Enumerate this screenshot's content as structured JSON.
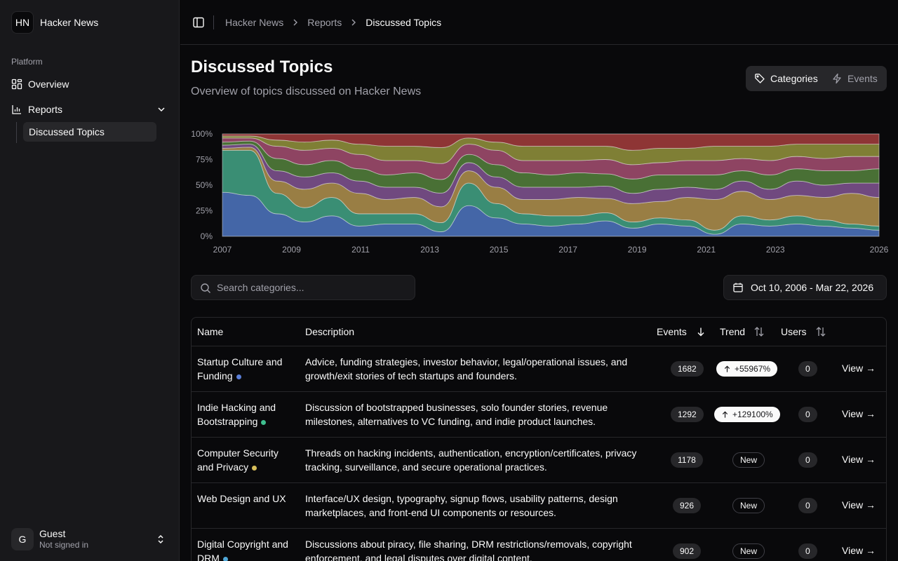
{
  "app": {
    "logo": "HN",
    "name": "Hacker News"
  },
  "sidebar": {
    "group_label": "Platform",
    "items": [
      {
        "label": "Overview",
        "icon": "layout-grid-icon"
      },
      {
        "label": "Reports",
        "icon": "bar-chart-icon"
      }
    ],
    "sub_items": [
      {
        "label": "Discussed Topics"
      }
    ]
  },
  "user": {
    "initial": "G",
    "name": "Guest",
    "status": "Not signed in"
  },
  "breadcrumb": [
    "Hacker News",
    "Reports",
    "Discussed Topics"
  ],
  "page": {
    "title": "Discussed Topics",
    "subtitle": "Overview of topics discussed on Hacker News"
  },
  "view_toggle": {
    "options": [
      "Categories",
      "Events"
    ],
    "active": "Categories"
  },
  "chart_data": {
    "type": "area",
    "stacked": "normalized",
    "x_ticks": [
      "2007",
      "2009",
      "2011",
      "2013",
      "2015",
      "2017",
      "2019",
      "2021",
      "2023",
      "2026"
    ],
    "y_ticks": [
      "0%",
      "25%",
      "50%",
      "75%",
      "100%"
    ],
    "ylim": [
      0,
      100
    ],
    "series": [
      {
        "color": "#4a6fb5",
        "values": [
          43,
          40,
          22,
          14,
          20,
          10,
          12,
          12,
          4,
          30,
          18,
          12,
          10,
          12,
          15,
          8,
          12,
          10,
          2,
          12,
          10,
          12,
          10,
          8,
          6
        ]
      },
      {
        "color": "#3f9a7e",
        "values": [
          41,
          44,
          20,
          14,
          18,
          12,
          10,
          10,
          8,
          22,
          14,
          10,
          10,
          8,
          8,
          6,
          6,
          6,
          4,
          8,
          6,
          8,
          6,
          4,
          4
        ]
      },
      {
        "color": "#a6894a",
        "values": [
          2,
          3,
          12,
          18,
          14,
          20,
          14,
          16,
          14,
          12,
          16,
          14,
          16,
          18,
          14,
          18,
          16,
          22,
          30,
          24,
          20,
          20,
          22,
          30,
          28
        ]
      },
      {
        "color": "#7a4f8a",
        "values": [
          3,
          3,
          10,
          12,
          10,
          12,
          12,
          10,
          12,
          8,
          10,
          12,
          12,
          10,
          12,
          10,
          12,
          10,
          10,
          10,
          10,
          14,
          12,
          10,
          14
        ]
      },
      {
        "color": "#4f7a3a",
        "values": [
          3,
          3,
          12,
          12,
          12,
          12,
          12,
          14,
          12,
          8,
          12,
          14,
          12,
          14,
          12,
          14,
          14,
          12,
          14,
          10,
          14,
          12,
          14,
          12,
          14
        ]
      },
      {
        "color": "#9a4a6a",
        "values": [
          4,
          3,
          12,
          14,
          12,
          14,
          14,
          12,
          14,
          10,
          14,
          12,
          14,
          12,
          14,
          14,
          12,
          14,
          14,
          12,
          14,
          12,
          12,
          14,
          12
        ]
      },
      {
        "color": "#8a8a3a",
        "values": [
          2,
          2,
          6,
          8,
          8,
          10,
          14,
          14,
          14,
          6,
          8,
          14,
          14,
          14,
          13,
          14,
          14,
          12,
          14,
          12,
          14,
          12,
          14,
          12,
          12
        ]
      },
      {
        "color": "#9a3a3a",
        "values": [
          2,
          2,
          6,
          8,
          6,
          10,
          12,
          12,
          12,
          4,
          8,
          12,
          12,
          12,
          12,
          16,
          14,
          14,
          12,
          12,
          12,
          10,
          10,
          10,
          10
        ]
      }
    ]
  },
  "search": {
    "placeholder": "Search categories..."
  },
  "date_range": {
    "label": "Oct 10, 2006 - Mar 22, 2026"
  },
  "table": {
    "columns": [
      "Name",
      "Description",
      "Events",
      "Trend",
      "Users"
    ],
    "view_label": "View →",
    "rows": [
      {
        "name": "Startup Culture and Funding",
        "dot": "#5b7fd8",
        "description": "Advice, funding strategies, investor behavior, legal/operational issues, and growth/exit stories of tech startups and founders.",
        "events": "1682",
        "trend": "+55967%",
        "trend_type": "up",
        "users": "0"
      },
      {
        "name": "Indie Hacking and Bootstrapping",
        "dot": "#3fbf8f",
        "description": "Discussion of bootstrapped businesses, solo founder stories, revenue milestones, alternatives to VC funding, and indie product launches.",
        "events": "1292",
        "trend": "+129100%",
        "trend_type": "up",
        "users": "0"
      },
      {
        "name": "Computer Security and Privacy",
        "dot": "#d8bf5b",
        "description": "Threads on hacking incidents, authentication, encryption/certificates, privacy tracking, surveillance, and secure operational practices.",
        "events": "1178",
        "trend": "New",
        "trend_type": "new",
        "users": "0"
      },
      {
        "name": "Web Design and UX",
        "dot": "",
        "description": "Interface/UX design, typography, signup flows, usability patterns, design marketplaces, and front-end UI components or resources.",
        "events": "926",
        "trend": "New",
        "trend_type": "new",
        "users": "0"
      },
      {
        "name": "Digital Copyright and DRM",
        "dot": "#4fa8d8",
        "description": "Discussions about piracy, file sharing, DRM restrictions/removals, copyright enforcement, and legal disputes over digital content.",
        "events": "902",
        "trend": "New",
        "trend_type": "new",
        "users": "0"
      }
    ]
  }
}
